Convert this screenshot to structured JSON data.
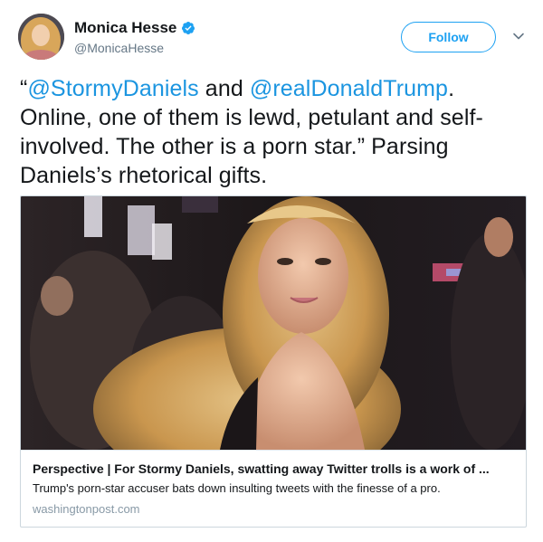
{
  "user": {
    "display_name": "Monica Hesse",
    "handle": "@MonicaHesse",
    "verified": true,
    "avatar_icon": "profile-photo"
  },
  "actions": {
    "follow_label": "Follow",
    "menu_icon": "chevron-down-icon"
  },
  "tweet": {
    "open_quote": "“",
    "mention_1": "@StormyDaniels",
    "and_word": " and ",
    "mention_2": "@realDonaldTrump",
    "rest": ". Online, one of them is lewd, petulant and self-involved. The other is a porn star.” Parsing Daniels’s rhetorical gifts."
  },
  "card": {
    "title": "Perspective | For Stormy Daniels, swatting away Twitter trolls is a work of ...",
    "description": "Trump's porn-star accuser bats down insulting tweets with the finesse of a pro.",
    "domain": "washingtonpost.com"
  },
  "colors": {
    "link_blue": "#1b95e0",
    "follow_blue": "#1da1f2",
    "verified_blue": "#1da1f2",
    "secondary_text": "#657786",
    "border": "#ccd6dd"
  }
}
